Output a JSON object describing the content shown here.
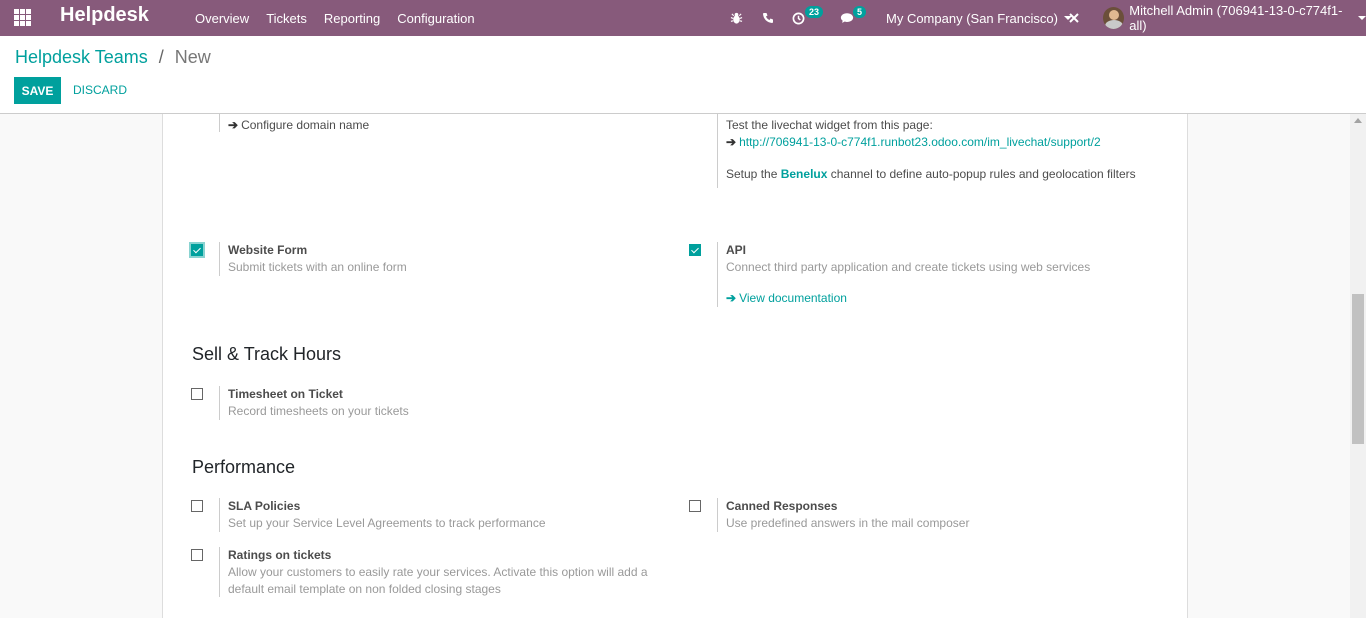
{
  "navbar": {
    "brand": "Helpdesk",
    "menu": [
      "Overview",
      "Tickets",
      "Reporting",
      "Configuration"
    ],
    "activity_count": "23",
    "messages_count": "5",
    "company": "My Company (San Francisco)",
    "user": "Mitchell Admin (706941-13-0-c774f1-all)"
  },
  "breadcrumb": {
    "parent": "Helpdesk Teams",
    "separator": "/",
    "current": "New"
  },
  "buttons": {
    "save": "SAVE",
    "discard": "DISCARD"
  },
  "top_left": {
    "configure_domain": "Configure domain name"
  },
  "livechat": {
    "test_text": "Test the livechat widget from this page:",
    "link": "http://706941-13-0-c774f1.runbot23.odoo.com/im_livechat/support/2",
    "setup_prefix": "Setup the ",
    "setup_channel": "Benelux",
    "setup_suffix": " channel to define auto-popup rules and geolocation filters"
  },
  "website_form": {
    "checked": true,
    "title": "Website Form",
    "desc": "Submit tickets with an online form"
  },
  "api": {
    "checked": true,
    "title": "API",
    "desc": "Connect third party application and create tickets using web services",
    "link": "View documentation"
  },
  "sections": {
    "sell_track": "Sell & Track Hours",
    "performance": "Performance"
  },
  "timesheet": {
    "checked": false,
    "title": "Timesheet on Ticket",
    "desc": "Record timesheets on your tickets"
  },
  "sla": {
    "checked": false,
    "title": "SLA Policies",
    "desc": "Set up your Service Level Agreements to track performance"
  },
  "canned": {
    "checked": false,
    "title": "Canned Responses",
    "desc": "Use predefined answers in the mail composer"
  },
  "ratings": {
    "checked": false,
    "title": "Ratings on tickets",
    "desc_line1": "Allow your customers to easily rate your services. Activate this option will add a",
    "desc_line2": "default email template on non folded closing stages"
  },
  "colors": {
    "navbar": "#875a7b",
    "accent": "#00a09d"
  }
}
